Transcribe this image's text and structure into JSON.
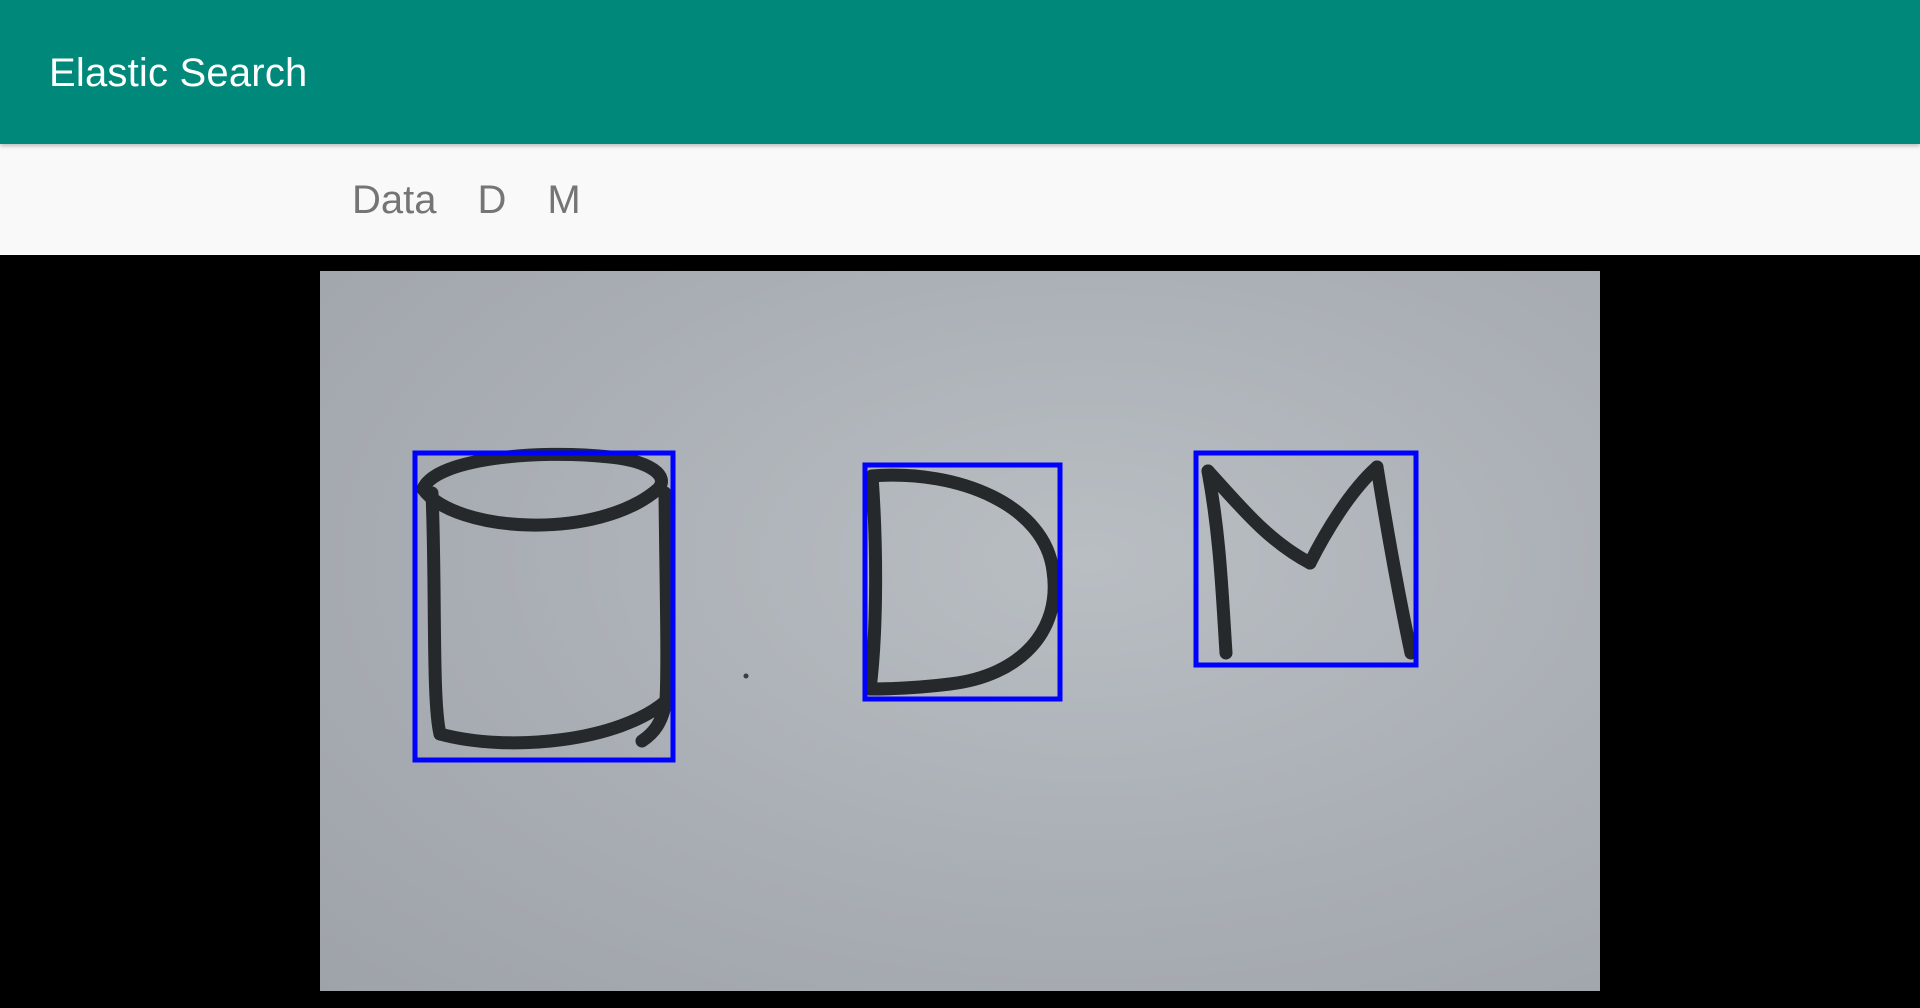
{
  "app_bar": {
    "title": "Elastic Search",
    "color": "#00897B"
  },
  "detected_labels": [
    {
      "label": "Data"
    },
    {
      "label": "D"
    },
    {
      "label": "M"
    }
  ],
  "camera_view": {
    "box_color": "#0000FF",
    "detections": [
      "Data",
      "D",
      "M"
    ]
  }
}
